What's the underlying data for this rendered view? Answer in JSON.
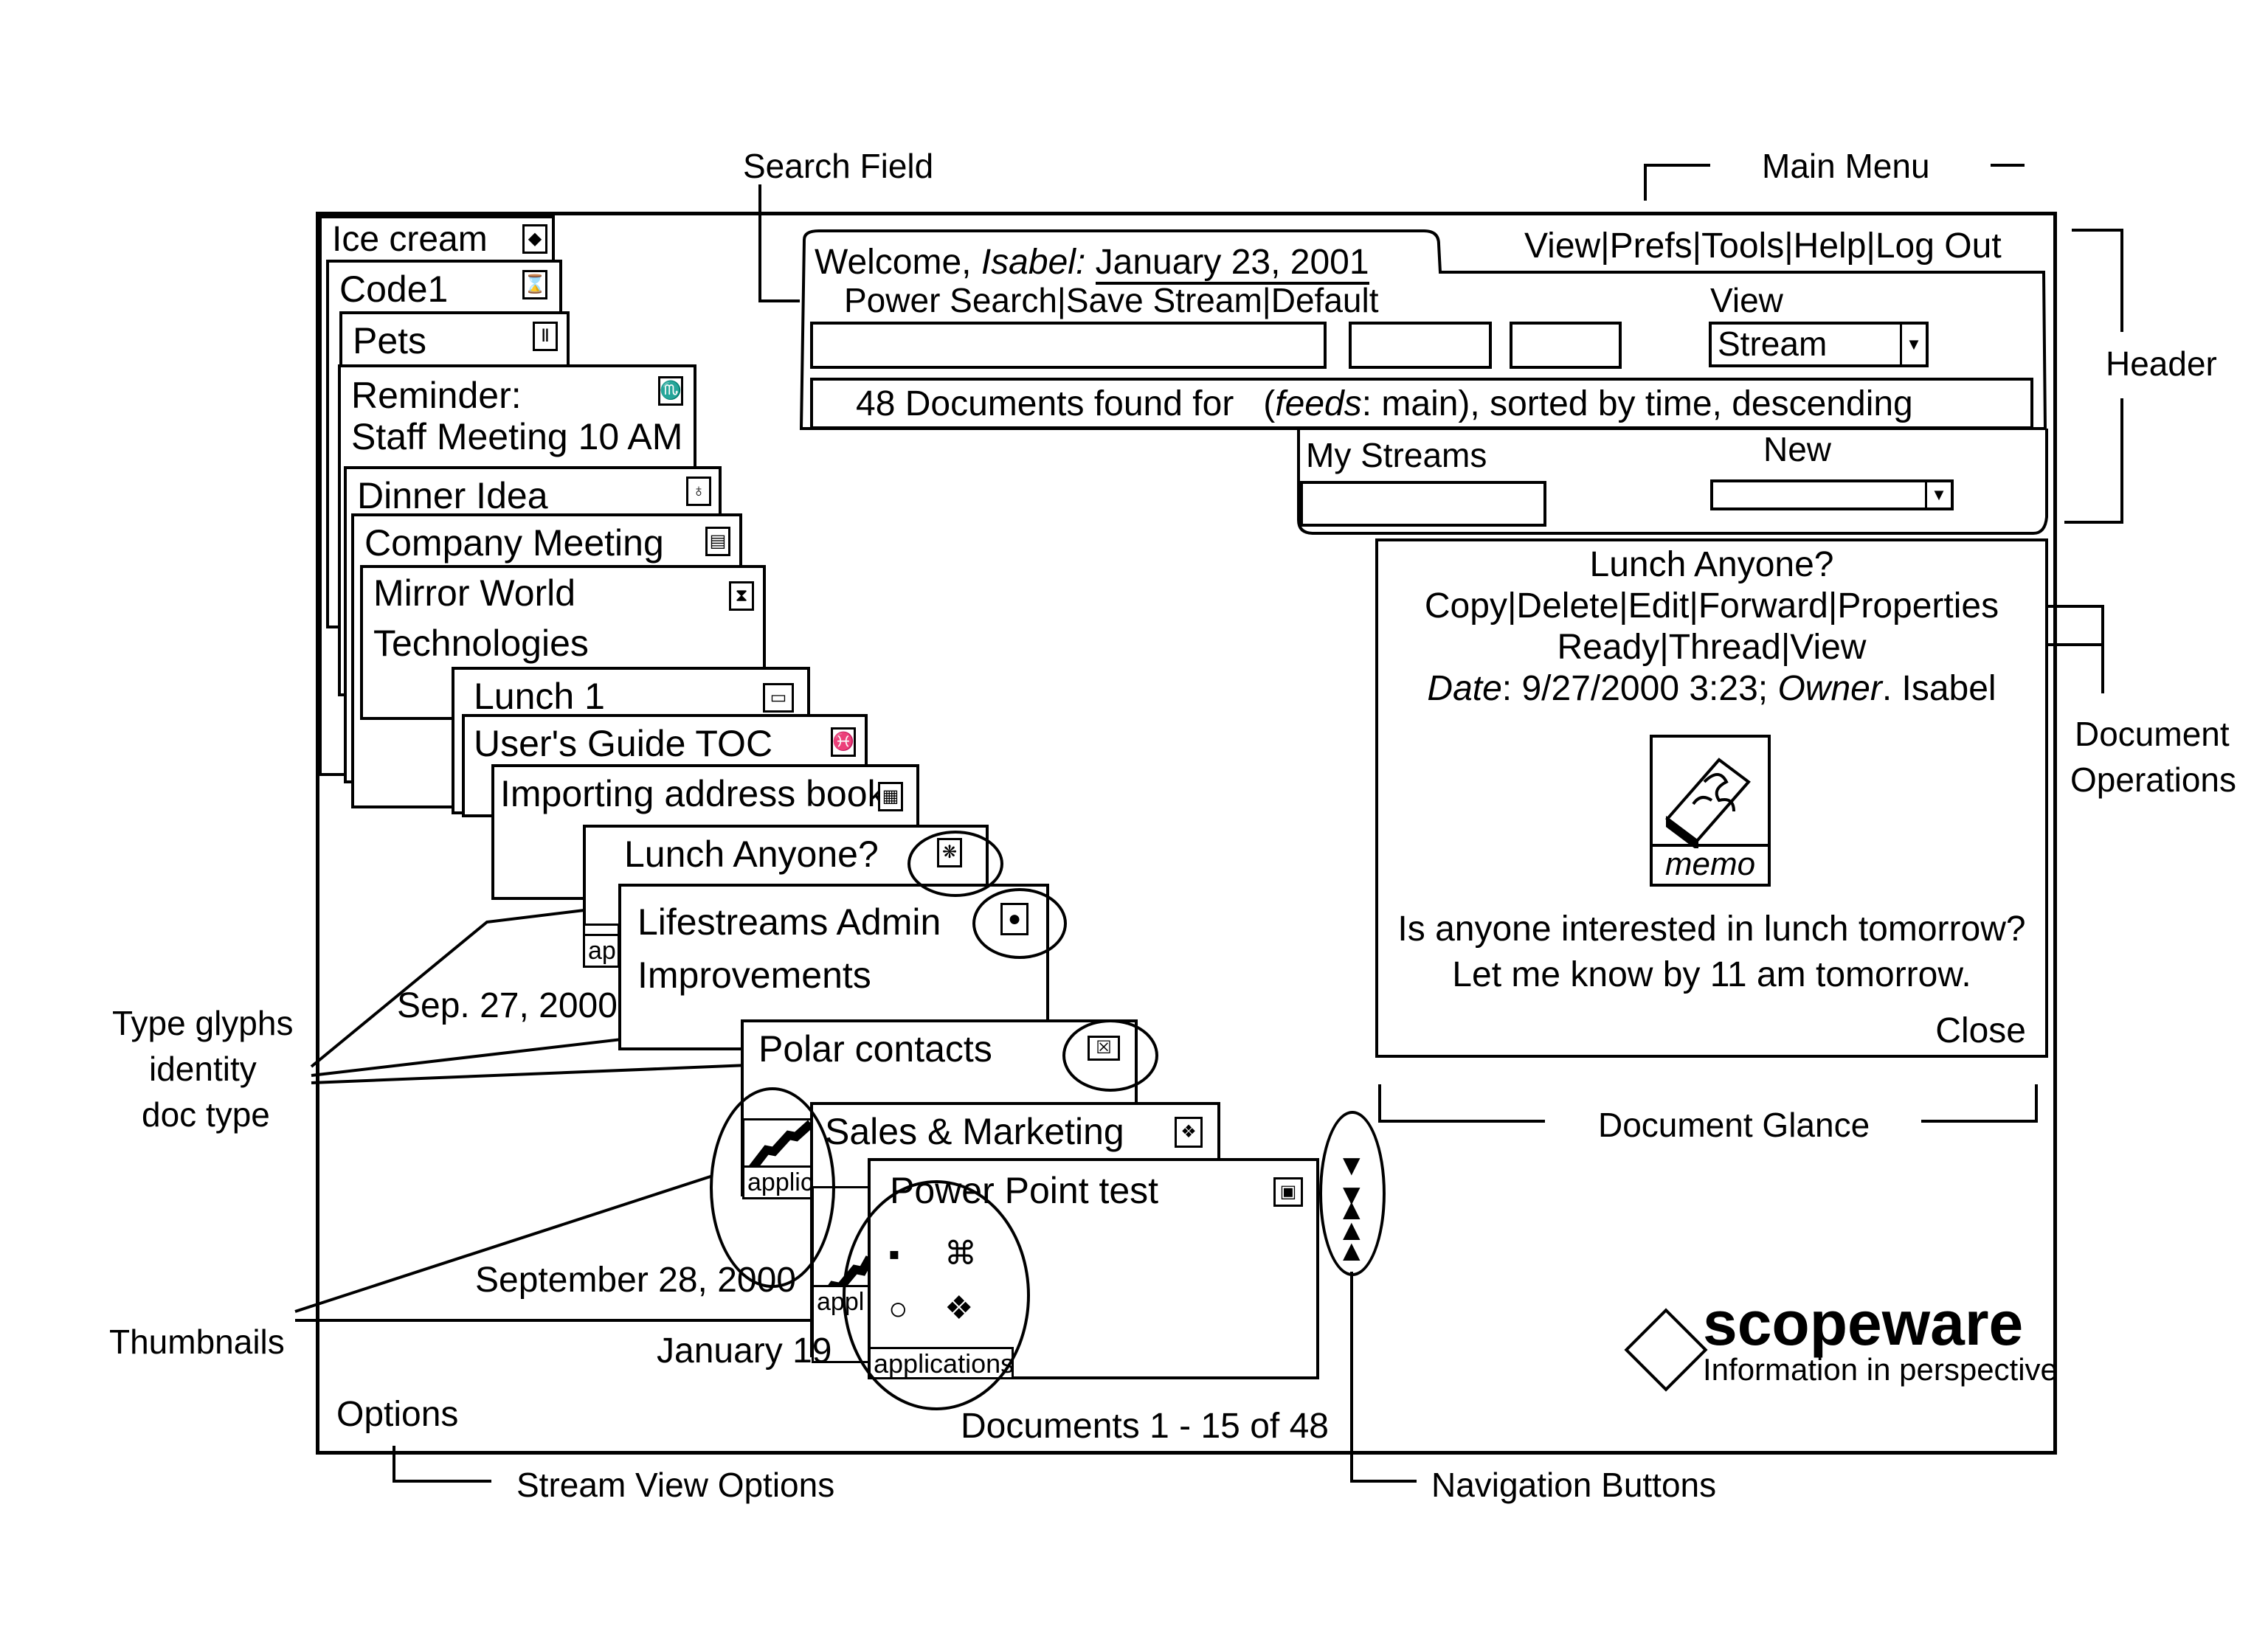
{
  "annotations": {
    "search_field": "Search Field",
    "main_menu": "Main Menu",
    "header": "Header",
    "document_operations_line1": "Document",
    "document_operations_line2": "Operations",
    "document_glance": "Document Glance",
    "type_glyphs_line1": "Type glyphs",
    "type_glyphs_line2": "identity",
    "type_glyphs_line3": "doc type",
    "thumbnails": "Thumbnails",
    "stream_view_options": "Stream View Options",
    "navigation_buttons": "Navigation Buttons"
  },
  "header": {
    "welcome_prefix": "Welcome, ",
    "user": "Isabel",
    "date": "January 23, 2001",
    "main_menu": [
      "View",
      "Prefs",
      "Tools",
      "Help",
      "Log Out"
    ],
    "search_links": [
      "Power Search",
      "Save Stream",
      "Default"
    ],
    "search_input_value": "",
    "extra_input_1_value": "",
    "extra_input_2_value": "",
    "view_label": "View",
    "view_selected": "Stream",
    "status_text": "48 Documents found for",
    "status_query_label": "feeds",
    "status_query_rest": ": main), sorted by time, descending",
    "my_streams_label": "My Streams",
    "my_streams_value": "",
    "new_label": "New",
    "new_selected": ""
  },
  "stream": {
    "documents": [
      {
        "title": "Ice cream",
        "glyph": "◆"
      },
      {
        "title": "Code1",
        "glyph": "⌛"
      },
      {
        "title": "Pets",
        "glyph": "Ⅱ"
      },
      {
        "title": "Reminder:",
        "title2": "Staff Meeting 10 AM",
        "glyph": "♏"
      },
      {
        "title": "Dinner Idea",
        "glyph": "♁"
      },
      {
        "title": "Company Meeting",
        "glyph": "▤"
      },
      {
        "title": "Mirror World",
        "title2": "Technologies",
        "glyph": "⧗"
      },
      {
        "title": "Lunch 1",
        "glyph": "▭"
      },
      {
        "title": "User's Guide TOC",
        "glyph": "♓"
      },
      {
        "title": "Importing address book",
        "glyph": "▦"
      },
      {
        "title": "Lunch Anyone?",
        "glyph": "❋"
      },
      {
        "title": "Lifestreams Admin",
        "title2": "Improvements",
        "glyph": "●"
      },
      {
        "title": "Polar contacts",
        "glyph": "☒"
      },
      {
        "title": "Sales & Marketing",
        "glyph": "❖"
      },
      {
        "title": "Power Point test",
        "glyph": "▣"
      }
    ],
    "date_markers": [
      "Sep. 27, 2000",
      "September 28, 2000",
      "January 19"
    ],
    "thumbnail_caption_short_1": "ap",
    "thumbnail_caption_short_2": "applic",
    "thumbnail_caption_short_3": "appl",
    "thumbnail_caption": "applications",
    "thumbnail_glyphs": [
      "▪",
      "⌘",
      "○",
      "❖"
    ],
    "options_label": "Options",
    "pagination": {
      "prefix": "Documents ",
      "range_start": "1",
      "sep": " - ",
      "range_end": "15",
      "suffix": " of 48"
    },
    "nav_down": "⯯",
    "nav_up": "⯭"
  },
  "glance": {
    "title": "Lunch Anyone?",
    "operations_row1": [
      "Copy",
      "Delete",
      "Edit",
      "Forward",
      "Properties"
    ],
    "operations_row2": [
      "Ready",
      "Thread",
      "View"
    ],
    "date_label": "Date",
    "date_value": ": 9/27/2000 3:23; ",
    "owner_label": "Owner",
    "owner_value": ". Isabel",
    "icon_caption": "memo",
    "body_line1": "Is anyone interested in lunch tomorrow?",
    "body_line2": "Let me know by 11 am tomorrow.",
    "close_label": "Close"
  },
  "brand": {
    "name": "scopeware",
    "tagline": "Information in perspective"
  }
}
